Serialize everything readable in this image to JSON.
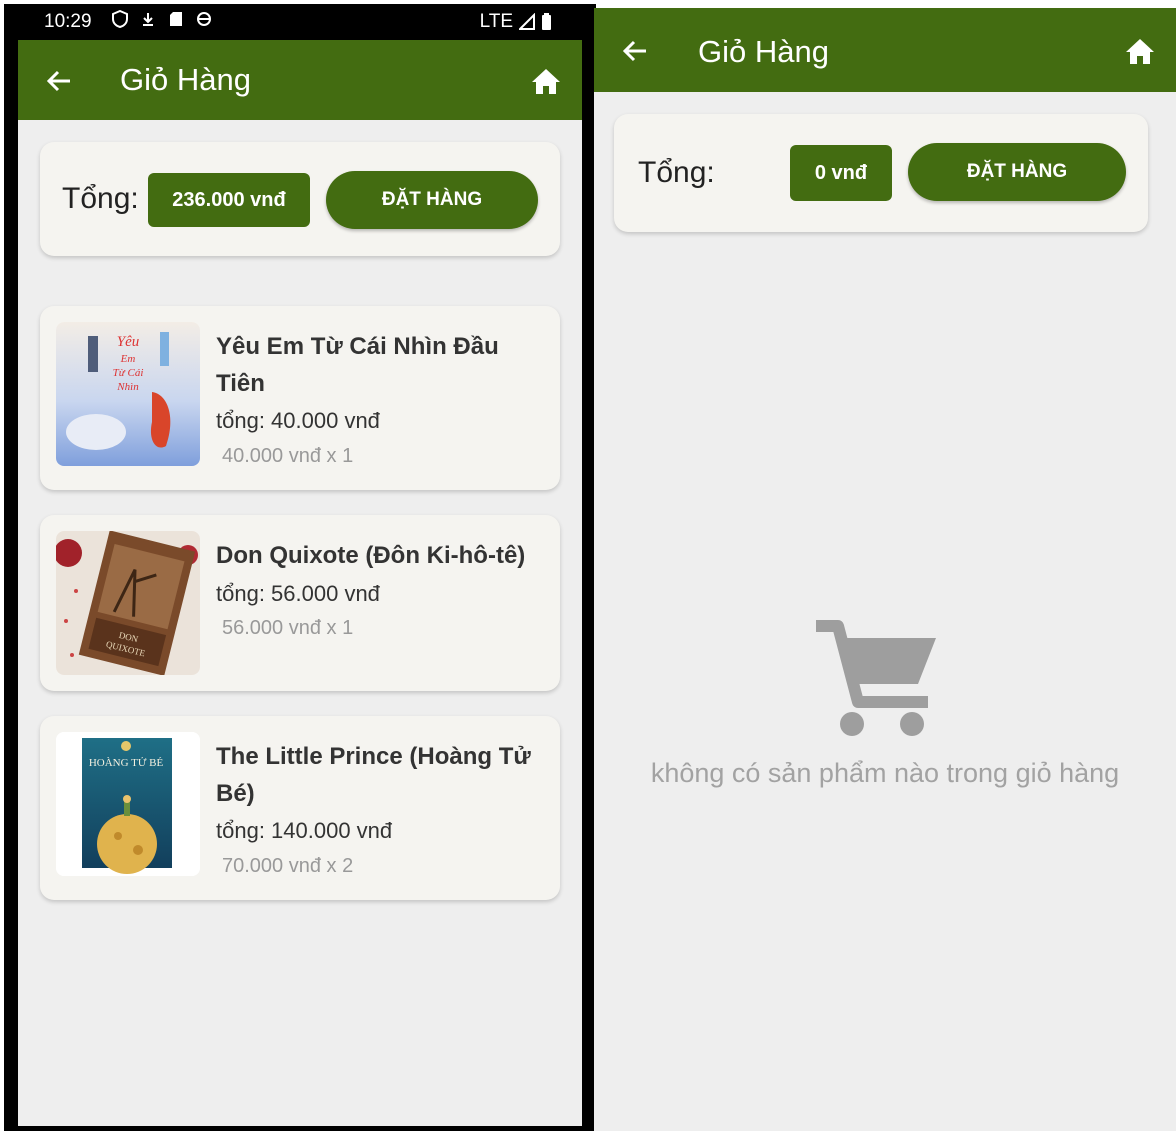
{
  "status_bar": {
    "time": "10:29",
    "network": "LTE",
    "icons": [
      "shield-icon",
      "download-icon",
      "sd-card-icon",
      "sync-icon",
      "signal-icon",
      "battery-icon"
    ]
  },
  "left_screen": {
    "appbar": {
      "title": "Giỏ Hàng",
      "back_icon": "arrow-back-icon",
      "home_icon": "home-icon"
    },
    "summary": {
      "total_label": "Tổng:",
      "total_value": "236.000 vnđ",
      "order_button": "ĐẶT HÀNG"
    },
    "items": [
      {
        "title": "Yêu Em Từ Cái Nhìn Đầu Tiên",
        "total": "tổng: 40.000 vnđ",
        "unit": "40.000 vnđ x 1",
        "cover_text": "Yêu Em Từ Cái Nhìn Đầu Tiên"
      },
      {
        "title": "Don Quixote (Đôn Ki-hô-tê)",
        "total": "tổng: 56.000 vnđ",
        "unit": "56.000 vnđ x 1",
        "cover_text": "DON QUIXOTE"
      },
      {
        "title": "The Little Prince (Hoàng Tử Bé)",
        "total": "tổng: 140.000 vnđ",
        "unit": "70.000 vnđ x 2",
        "cover_text": "HOÀNG TỬ BÉ"
      }
    ]
  },
  "right_screen": {
    "appbar": {
      "title": "Giỏ Hàng",
      "back_icon": "arrow-back-icon",
      "home_icon": "home-icon"
    },
    "summary": {
      "total_label": "Tổng:",
      "total_value": "0 vnđ",
      "order_button": "ĐẶT HÀNG"
    },
    "empty_icon": "shopping-cart-icon",
    "empty_message": "không có sản phẩm nào trong giỏ hàng"
  },
  "colors": {
    "primary": "#436c11",
    "background": "#eeeeee",
    "card": "#f5f4f0",
    "muted_text": "#999999"
  }
}
